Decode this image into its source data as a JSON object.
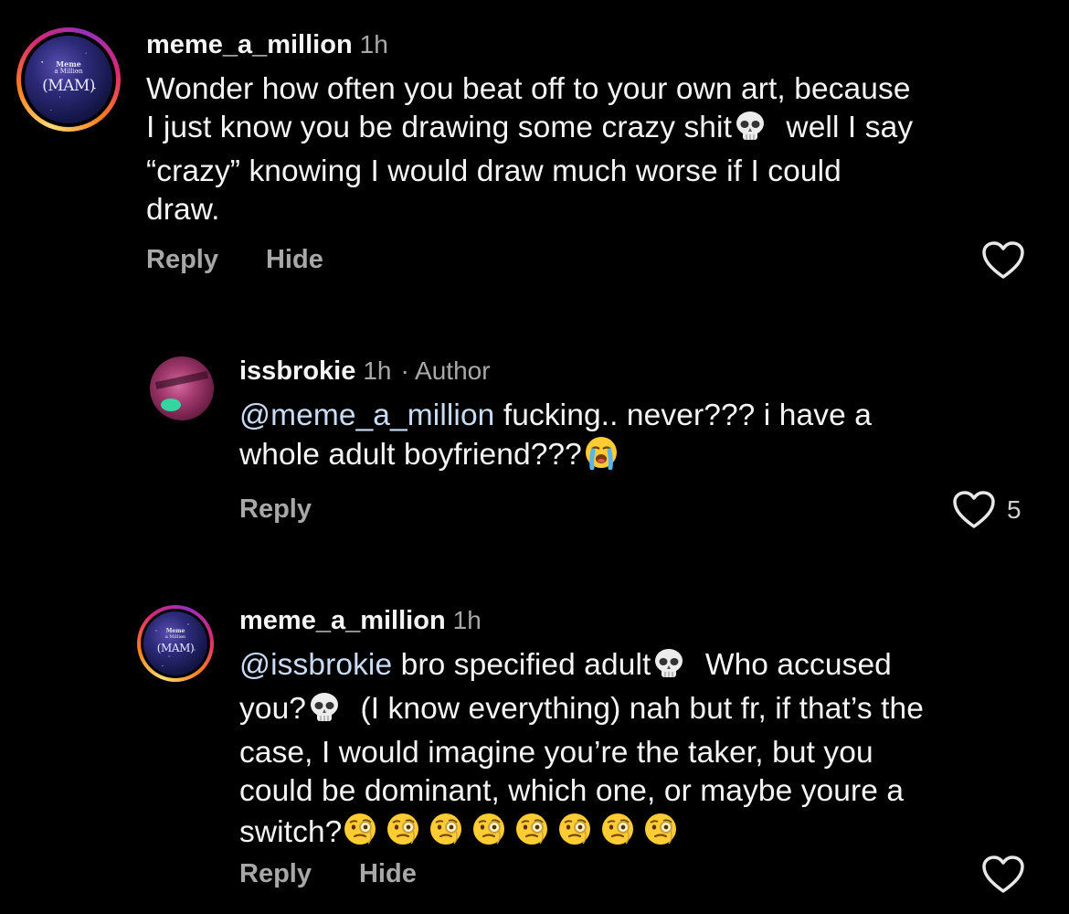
{
  "comments": [
    {
      "username": "meme_a_million",
      "time": "1h",
      "avatar_text": [
        "Meme",
        "a Million",
        "(MAM)"
      ],
      "lines": [
        "Wonder how often you beat off to your own art, because",
        "I just know you be drawing some crazy shit",
        "well I say",
        "“crazy” knowing I would draw much worse if I could",
        "draw."
      ],
      "actions": {
        "reply": "Reply",
        "hide": "Hide"
      }
    },
    {
      "username": "issbrokie",
      "time": "1h",
      "author_tag": "· Author",
      "mention": "@meme_a_million",
      "lines": [
        "fucking.. never??? i have a",
        "whole adult boyfriend???"
      ],
      "actions": {
        "reply": "Reply"
      },
      "likes": "5"
    },
    {
      "username": "meme_a_million",
      "time": "1h",
      "avatar_text": [
        "Meme",
        "a Million",
        "(MAM)"
      ],
      "mention": "@issbrokie",
      "lines": [
        "bro specified adult",
        "Who accused",
        "you?",
        "(I know everything) nah but fr, if that’s the",
        "case, I would imagine you’re the taker, but you",
        "could be dominant, which one, or maybe youre a",
        "switch?"
      ],
      "actions": {
        "reply": "Reply",
        "hide": "Hide"
      }
    }
  ],
  "icons": {
    "emoji_skull": "skull-emoji",
    "emoji_cry": "loudly-crying-emoji",
    "emoji_monocle": "face-with-monocle-emoji",
    "heart": "heart-outline-icon"
  }
}
